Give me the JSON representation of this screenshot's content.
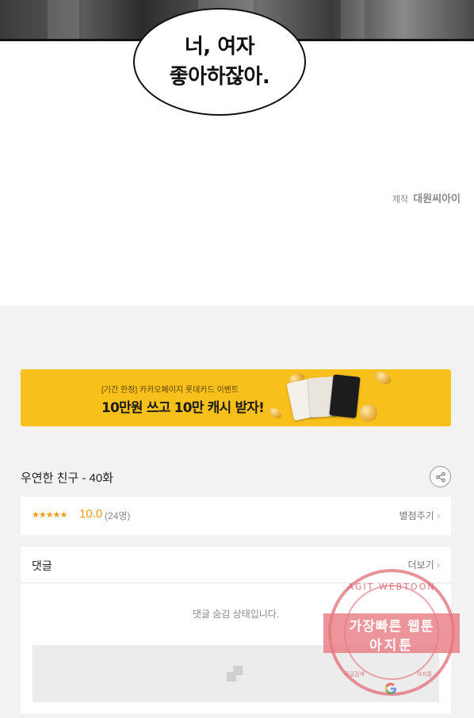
{
  "comic": {
    "speech_bubble": {
      "line1": "너, 여자",
      "line2": "좋아하잖아."
    },
    "credit": {
      "label": "제작",
      "studio": "대원씨아이"
    }
  },
  "banner": {
    "subtitle": "[기간 한정] 카카오페이지 롯데카드 이벤트",
    "headline": "10만원 쓰고 10만 캐시 받자!",
    "accent_color": "#f8c01b"
  },
  "episode": {
    "title": "우연한 친구 - 40화",
    "share_icon": "share-icon"
  },
  "rating": {
    "stars": "★★★★★",
    "score": "10.0",
    "count": "(24명)",
    "rate_button": "별점주기",
    "color": "#f29a14"
  },
  "comments": {
    "title": "댓글",
    "more_button": "더보기",
    "hidden_message": "댓글 숨김 상태입니다."
  },
  "watermark": {
    "top_text": "AGIT WEBTOON",
    "line1": "가장빠른 웹툰",
    "line2": "아지툰",
    "bottom_left": "구글검색",
    "bottom_right": "아지툰",
    "color": "#e26e78"
  }
}
